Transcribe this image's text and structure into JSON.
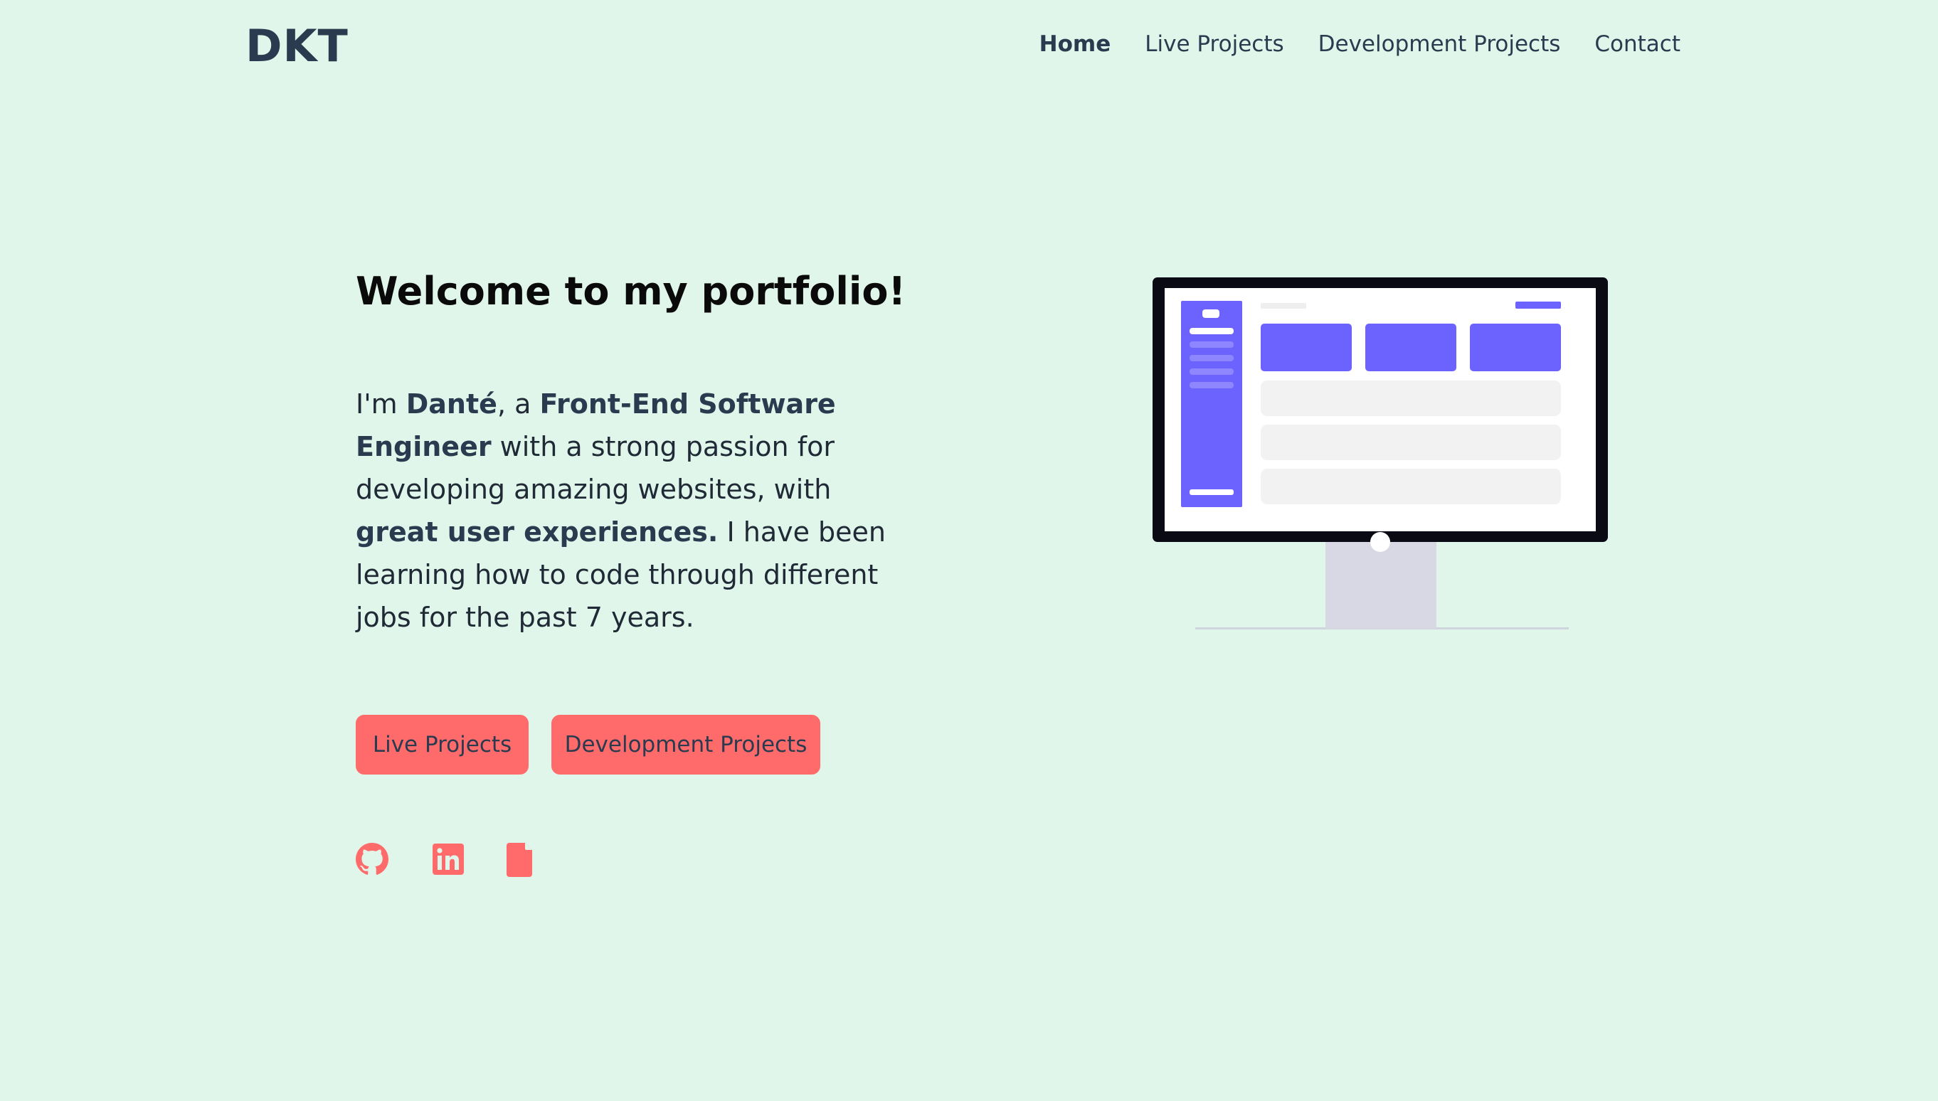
{
  "brand": {
    "logo_text": "DKT"
  },
  "nav": {
    "items": [
      {
        "label": "Home",
        "active": true
      },
      {
        "label": "Live Projects",
        "active": false
      },
      {
        "label": "Development Projects",
        "active": false
      },
      {
        "label": "Contact",
        "active": false
      }
    ]
  },
  "hero": {
    "title": "Welcome to my portfolio!",
    "intro": {
      "p1": "I'm ",
      "name": "Danté",
      "p2": ", a ",
      "role": "Front-End Software Engineer",
      "p3": " with a strong passion for developing amazing websites, with ",
      "highlight": "great user experiences.",
      "p4": " I have been learning how to code through different jobs for the past 7 years."
    },
    "buttons": {
      "live_projects": "Live Projects",
      "development_projects": "Development Projects"
    }
  },
  "social": {
    "icons": [
      "github-icon",
      "linkedin-icon",
      "resume-document-icon"
    ]
  },
  "colors": {
    "background": "#e1f6ea",
    "accent": "#ff6b6b",
    "text": "#2a3b4f",
    "illustration_accent": "#6c63ff"
  }
}
